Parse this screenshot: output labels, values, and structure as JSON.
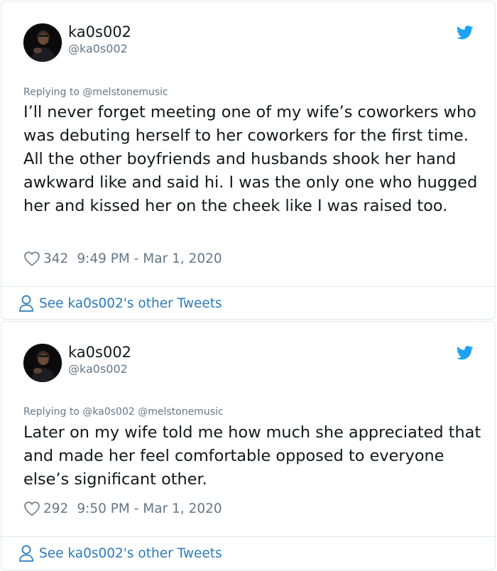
{
  "colors": {
    "text": "#14171a",
    "muted": "#657786",
    "link": "#2b7bb9",
    "twitter_blue": "#1da1f2",
    "border": "#e1e8ed"
  },
  "tweets": [
    {
      "display_name": "ka0s002",
      "handle": "@ka0s002",
      "replying_prefix": "Replying to ",
      "mentions": "@melstonemusic",
      "text": "I’ll never forget meeting one of my wife’s coworkers who was debuting herself to her coworkers for the first time. All the other boyfriends and husbands shook her hand awkward like and said hi. I was the only one who hugged her and kissed her on the cheek like I was raised too.",
      "likes": "342",
      "timestamp": "9:49 PM - Mar 1, 2020",
      "see_more": "See ka0s002's other Tweets",
      "icons": {
        "avatar": "avatar",
        "brand": "twitter-bird-icon",
        "like": "heart-icon",
        "profile": "person-icon"
      }
    },
    {
      "display_name": "ka0s002",
      "handle": "@ka0s002",
      "replying_prefix": "Replying to ",
      "mentions": "@ka0s002 @melstonemusic",
      "text": "Later on my wife told me how much she appreciated that and made her feel comfortable opposed to everyone else’s significant other.",
      "likes": "292",
      "timestamp": "9:50 PM - Mar 1, 2020",
      "see_more": "See ka0s002's other Tweets",
      "icons": {
        "avatar": "avatar",
        "brand": "twitter-bird-icon",
        "like": "heart-icon",
        "profile": "person-icon"
      }
    }
  ]
}
